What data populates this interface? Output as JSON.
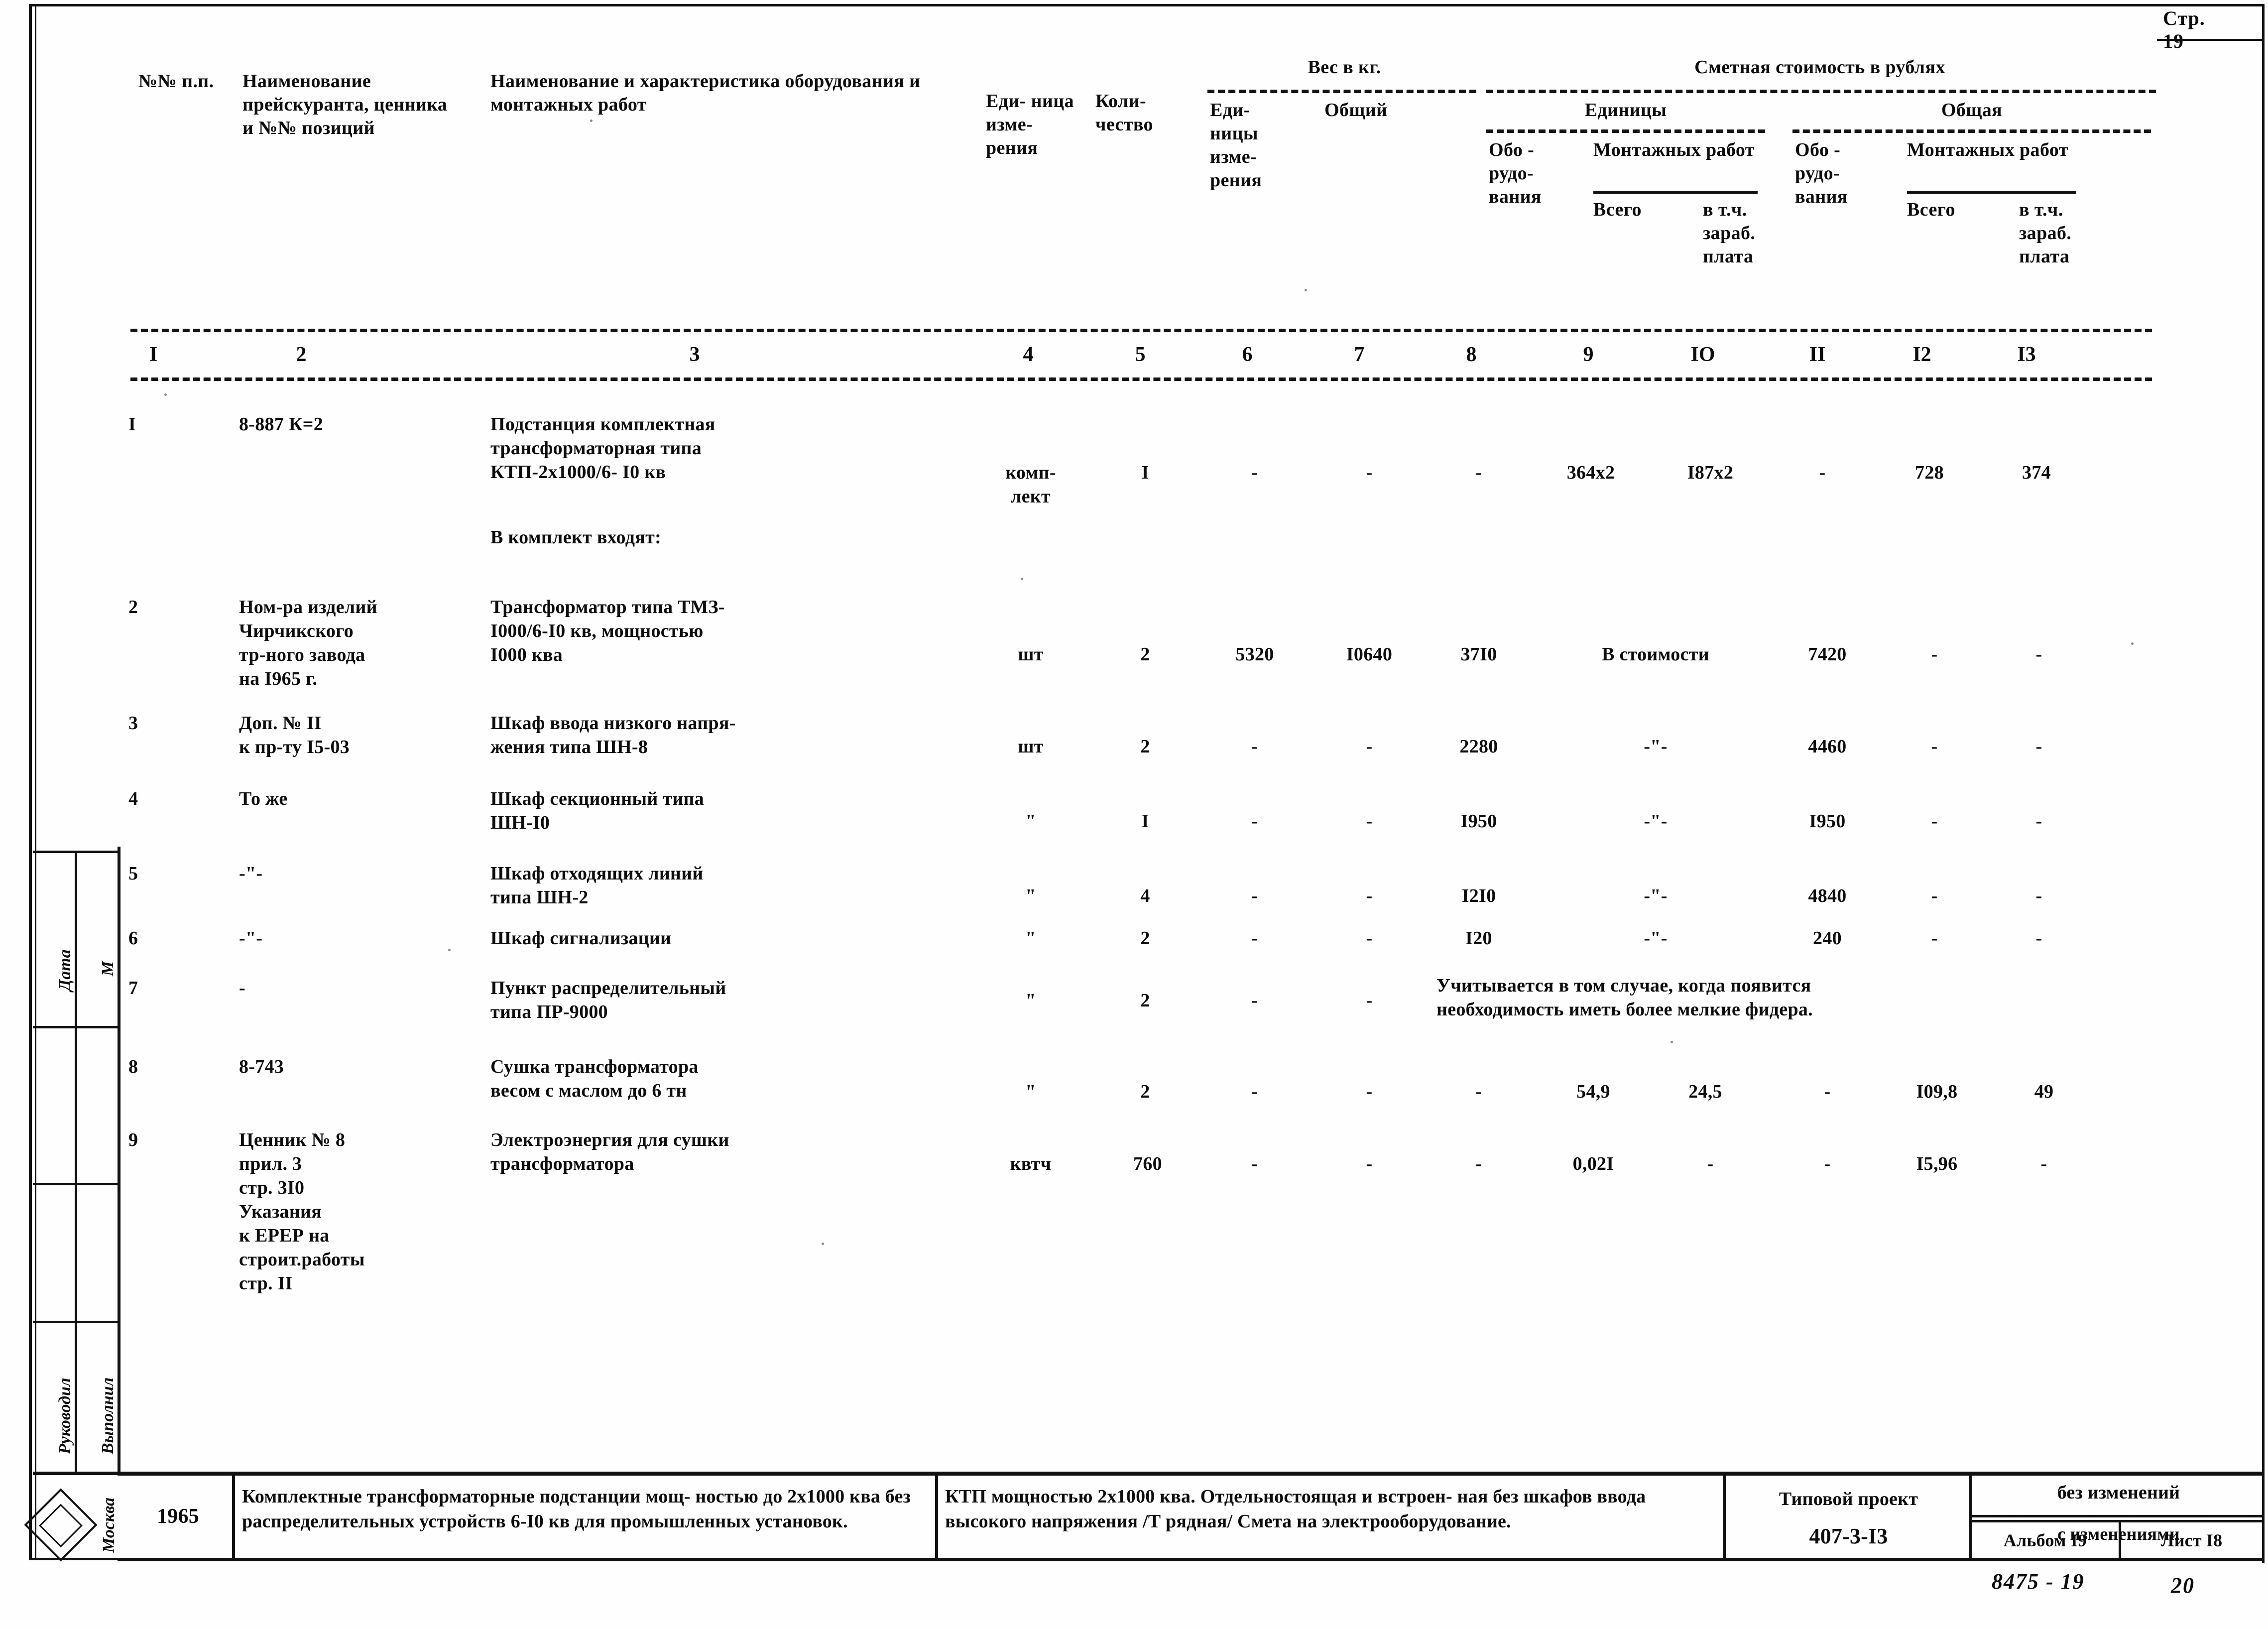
{
  "page": {
    "page_label": "Стр.",
    "page_number": "19"
  },
  "header": {
    "col1": "№№\nп.п.",
    "col2": "Наименование\nпрейскуранта,\nценника и №№\nпозиций",
    "col3": "Наименование и характеристика\nоборудования  и  монтажных\nработ",
    "col4": "Еди-\nница\nизме-\nрения",
    "col5": "Коли-\nчество",
    "weight_group": "Вес в кг.",
    "col6": "Еди-\nницы\nизме-\nрения",
    "col7": "Общий",
    "cost_group": "Сметная стоимость в рублях",
    "unit_group": "Единицы",
    "total_group": "Общая",
    "col8": "Обо -\nрудо-\nвания",
    "col9_10_group": "Монтажных\nработ",
    "col9": "Всего",
    "col10": "в т.ч.\nзараб.\nплата",
    "col11": "Обо -\nрудо-\nвания",
    "col12_13_group": "Монтажных\nработ",
    "col12": "Всего",
    "col13": "в т.ч.\nзараб.\nплата"
  },
  "column_numbers": [
    "I",
    "2",
    "3",
    "4",
    "5",
    "6",
    "7",
    "8",
    "9",
    "IO",
    "II",
    "I2",
    "I3"
  ],
  "rows": [
    {
      "no": "I",
      "ref": "8-887  К=2",
      "name": "Подстанция комплектная\nтрансформаторная типа\nКТП-2х1000/6- I0 кв",
      "unit": "комп-\nлект",
      "qty": "I",
      "w_unit": "-",
      "w_total": "-",
      "u_equip": "-",
      "u_mont_total": "364х2",
      "u_mont_wage": "I87х2",
      "t_equip": "-",
      "t_mont_total": "728",
      "t_mont_wage": "374"
    },
    {
      "no": "",
      "ref": "",
      "name": "В комплект входят:",
      "unit": "",
      "qty": "",
      "w_unit": "",
      "w_total": "",
      "u_equip": "",
      "u_mont_total": "",
      "u_mont_wage": "",
      "t_equip": "",
      "t_mont_total": "",
      "t_mont_wage": ""
    },
    {
      "no": "2",
      "ref": "Ном-ра изделий\nЧирчикского\nтр-ного завода\nна I965 г.",
      "name": "Трансформатор типа ТМЗ-\nI000/6-I0 кв, мощностью\nI000 ква",
      "unit": "шт",
      "qty": "2",
      "w_unit": "5320",
      "w_total": "I0640",
      "u_equip": "37I0",
      "u_mont_span": "В стоимости",
      "t_equip": "7420",
      "t_mont_total": "-",
      "t_mont_wage": "-"
    },
    {
      "no": "3",
      "ref": "Доп. № II\nк пр-ту I5-03",
      "name": "Шкаф ввода низкого напря-\nжения типа ШН-8",
      "unit": "шт",
      "qty": "2",
      "w_unit": "-",
      "w_total": "-",
      "u_equip": "2280",
      "u_mont_span": "-\"-",
      "t_equip": "4460",
      "t_mont_total": "-",
      "t_mont_wage": "-"
    },
    {
      "no": "4",
      "ref": "То же",
      "name": "Шкаф секционный типа\nШН-I0",
      "unit": "\"",
      "qty": "I",
      "w_unit": "-",
      "w_total": "-",
      "u_equip": "I950",
      "u_mont_span": "-\"-",
      "t_equip": "I950",
      "t_mont_total": "-",
      "t_mont_wage": "-"
    },
    {
      "no": "5",
      "ref": "-\"-",
      "name": "Шкаф отходящих линий\nтипа ШН-2",
      "unit": "\"",
      "qty": "4",
      "w_unit": "-",
      "w_total": "-",
      "u_equip": "I2I0",
      "u_mont_span": "-\"-",
      "t_equip": "4840",
      "t_mont_total": "-",
      "t_mont_wage": "-"
    },
    {
      "no": "6",
      "ref": "-\"-",
      "name": "Шкаф сигнализации",
      "unit": "\"",
      "qty": "2",
      "w_unit": "-",
      "w_total": "-",
      "u_equip": "I20",
      "u_mont_span": "-\"-",
      "t_equip": "240",
      "t_mont_total": "-",
      "t_mont_wage": "-"
    },
    {
      "no": "7",
      "ref": "-",
      "name": "Пункт распределительный\nтипа ПР-9000",
      "unit": "\"",
      "qty": "2",
      "w_unit": "-",
      "w_total": "-",
      "note_span": "Учитывается в том случае, когда появится\nнеобходимость иметь более мелкие фидера."
    },
    {
      "no": "8",
      "ref": "8-743",
      "name": "Сушка трансформатора\nвесом с маслом до 6 тн",
      "unit": "\"",
      "qty": "2",
      "w_unit": "-",
      "w_total": "-",
      "u_equip": "-",
      "u_mont_total": "54,9",
      "u_mont_wage": "24,5",
      "t_equip": "-",
      "t_mont_total": "I09,8",
      "t_mont_wage": "49"
    },
    {
      "no": "9",
      "ref": "Ценник № 8\nприл. 3\nстр. 3I0\nУказания\nк ЕРЕР на\nстроит.работы\nстр. II",
      "name": "Электроэнергия для сушки\nтрансформатора",
      "unit": "квтч",
      "qty": "760",
      "w_unit": "-",
      "w_total": "-",
      "u_equip": "-",
      "u_mont_total": "0,02I",
      "u_mont_wage": "-",
      "t_equip": "-",
      "t_mont_total": "I5,96",
      "t_mont_wage": "-"
    }
  ],
  "title_block": {
    "year": "1965",
    "description": "Комплектные трансформаторные подстанции мощ-\nностью до 2х1000 ква без распределительных\nустройств 6-I0 кв для промышленных установок.",
    "subject": "КТП мощностью 2х1000 ква. Отдельностоящая и встроен-\nная без шкафов ввода высокого напряжения /Т рядная/\nСмета на электрооборудование.",
    "project_label": "Типовой проект",
    "project_code": "407-3-I3",
    "no_changes": "без изменений",
    "with_changes": "с изменениями",
    "album": "Альбом I9",
    "sheet": "Лист  I8",
    "hand_code": "8475 - 19",
    "hand_page": "20"
  },
  "margin": {
    "date": "Дата",
    "scale": "М",
    "supervised": "Руководил",
    "executed": "Выполнил",
    "city": "Москва"
  }
}
